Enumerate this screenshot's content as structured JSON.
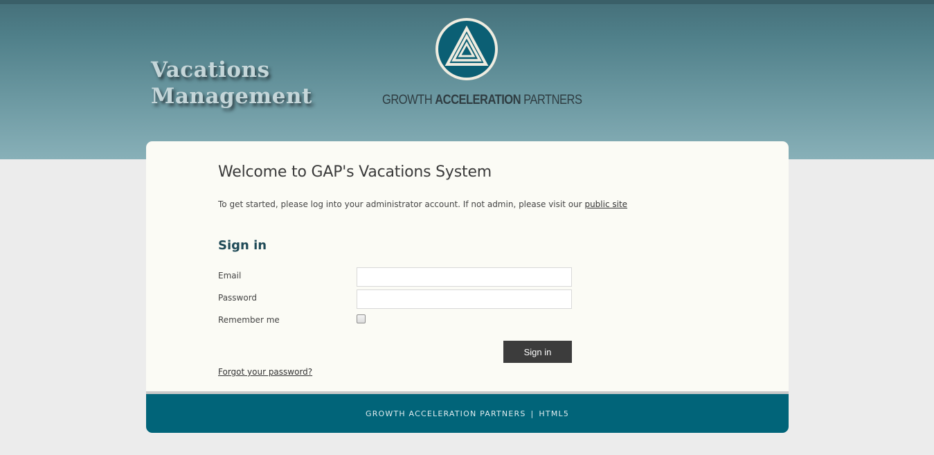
{
  "header": {
    "title_line1": "Vacations",
    "title_line2": "Management",
    "logo_text_1": "GROWTH ",
    "logo_text_2": "ACCELERATION",
    "logo_text_3": " PARTNERS"
  },
  "main": {
    "welcome": "Welcome to GAP's Vacations System",
    "intro_text": "To get started, please log into your administrator account. If not admin, please visit our ",
    "public_site_link": "public site",
    "signin_heading": "Sign in",
    "email_label": "Email",
    "email_value": "",
    "password_label": "Password",
    "password_value": "",
    "remember_label": "Remember me",
    "remember_checked": false,
    "signin_button": "Sign in",
    "forgot_link": "Forgot your password?"
  },
  "footer": {
    "company": "GROWTH ACCELERATION PARTNERS",
    "separator": "|",
    "tech": "HTML5"
  },
  "colors": {
    "accent": "#016479",
    "header_top": "#46717b",
    "header_bottom": "#88b0b8",
    "card_bg": "#fbfbf5",
    "button_bg": "#3c3c3c"
  },
  "icons": {
    "logo": "triangle-spiral-logo-icon",
    "checkbox": "checkbox-icon"
  }
}
